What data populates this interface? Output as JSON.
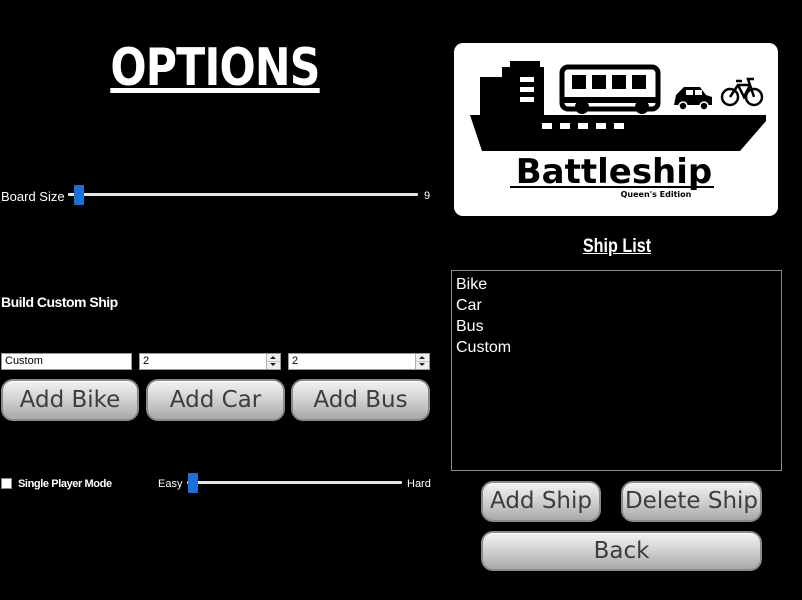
{
  "title": "OPTIONS",
  "board_size": {
    "label": "Board Size",
    "value": "9",
    "slider_fraction": 0.0
  },
  "custom_ship": {
    "heading": "Build Custom Ship",
    "name_value": "Custom",
    "spinner1_value": "2",
    "spinner2_value": "2",
    "add_bike": "Add Bike",
    "add_car": "Add Car",
    "add_bus": "Add Bus"
  },
  "single_player": {
    "label": "Single Player Mode",
    "checked": false,
    "easy": "Easy",
    "hard": "Hard",
    "difficulty_fraction": 0.0
  },
  "logo": {
    "title": "Battleship",
    "subtitle": "Queen's Edition"
  },
  "ship_list": {
    "title": "Ship List",
    "items": [
      "Bike",
      "Car",
      "Bus",
      "Custom"
    ]
  },
  "buttons": {
    "add_ship": "Add Ship",
    "delete_ship": "Delete Ship",
    "back": "Back"
  },
  "colors": {
    "accent": "#1a72d6",
    "background": "#000000"
  }
}
